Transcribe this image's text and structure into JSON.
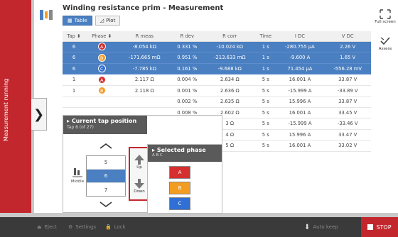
{
  "status": {
    "running_label": "Measurement running"
  },
  "header": {
    "title": "Winding resistance prim - Measurement"
  },
  "view_tabs": [
    {
      "label": "Table",
      "active": true
    },
    {
      "label": "Plot",
      "active": false
    }
  ],
  "side_tools": {
    "fullscreen_label": "Full screen",
    "assess_label": "Assess"
  },
  "table": {
    "columns": [
      "Tap",
      "Phase",
      "R meas",
      "R dev",
      "R corr",
      "Time",
      "I DC",
      "V DC"
    ],
    "rows": [
      {
        "tap": "6",
        "phase": "A",
        "r_meas": "-8.054 kΩ",
        "r_dev": "0.331 %",
        "r_corr": "-10.024 kΩ",
        "time": "1 s",
        "i_dc": "-280.755 μA",
        "v_dc": "2.26 V",
        "selected": true
      },
      {
        "tap": "6",
        "phase": "B",
        "r_meas": "-171.665 mΩ",
        "r_dev": "0.951 %",
        "r_corr": "-213.633 mΩ",
        "time": "1 s",
        "i_dc": "-9.600 A",
        "v_dc": "1.65 V",
        "selected": true
      },
      {
        "tap": "6",
        "phase": "C",
        "r_meas": "-7.785 kΩ",
        "r_dev": "0.161 %",
        "r_corr": "-9.688 kΩ",
        "time": "1 s",
        "i_dc": "71.454 μA",
        "v_dc": "-556.28 mV",
        "selected": true
      },
      {
        "tap": "1",
        "phase": "A",
        "r_meas": "2.117 Ω",
        "r_dev": "0.004 %",
        "r_corr": "2.634 Ω",
        "time": "5 s",
        "i_dc": "16.001 A",
        "v_dc": "33.87 V",
        "selected": false
      },
      {
        "tap": "1",
        "phase": "B",
        "r_meas": "2.118 Ω",
        "r_dev": "0.001 %",
        "r_corr": "2.636 Ω",
        "time": "5 s",
        "i_dc": "-15.999 A",
        "v_dc": "-33.89 V",
        "selected": false
      },
      {
        "tap": "",
        "phase": "",
        "r_meas": "",
        "r_dev": "0.002 %",
        "r_corr": "2.635 Ω",
        "time": "5 s",
        "i_dc": "15.996 A",
        "v_dc": "33.87 V",
        "selected": false
      },
      {
        "tap": "",
        "phase": "",
        "r_meas": "",
        "r_dev": "0.008 %",
        "r_corr": "2.602 Ω",
        "time": "5 s",
        "i_dc": "16.001 A",
        "v_dc": "33.45 V",
        "selected": false
      },
      {
        "tap": "",
        "phase": "",
        "r_meas": "",
        "r_dev": "",
        "r_corr": "3 Ω",
        "time": "5 s",
        "i_dc": "-15.999 A",
        "v_dc": "-33.46 V",
        "selected": false
      },
      {
        "tap": "",
        "phase": "",
        "r_meas": "",
        "r_dev": "",
        "r_corr": "4 Ω",
        "time": "5 s",
        "i_dc": "15.996 A",
        "v_dc": "33.47 V",
        "selected": false
      },
      {
        "tap": "",
        "phase": "",
        "r_meas": "",
        "r_dev": "",
        "r_corr": "5 Ω",
        "time": "5 s",
        "i_dc": "16.001 A",
        "v_dc": "33.02 V",
        "selected": false
      }
    ]
  },
  "tap_popup": {
    "title": "Current tap position",
    "subtitle": "Tap 6 (of 27)",
    "transformer_label": "Middle",
    "taps": [
      "5",
      "6",
      "7"
    ],
    "selected_tap": "6",
    "up_label": "Up",
    "down_label": "Down"
  },
  "phase_popup": {
    "title": "Selected phase",
    "subtitle": "A B C",
    "phases": [
      "A",
      "B",
      "C"
    ]
  },
  "bottom_bar": {
    "eject_label": "Eject",
    "settings_label": "Settings",
    "lock_label": "Lock",
    "autokeep_label": "Auto keep",
    "stop_label": "STOP"
  },
  "colors": {
    "accent_red": "#c3272e",
    "selection_blue": "#4a7fc1",
    "phase_a": "#d62f2f",
    "phase_b": "#f39c22",
    "phase_c": "#2f6fd6"
  }
}
